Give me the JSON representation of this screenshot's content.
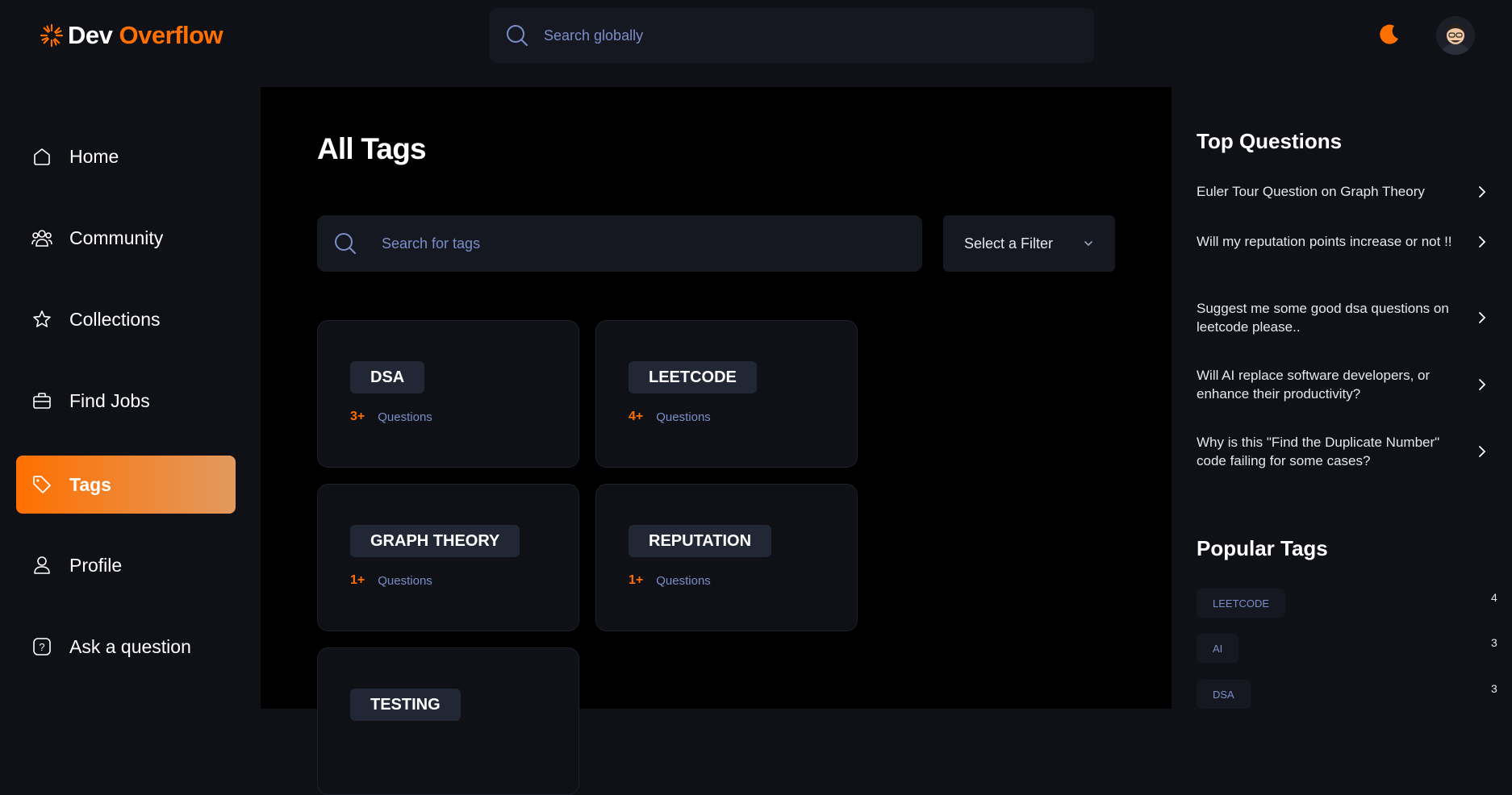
{
  "brand": {
    "name_part1": "Dev",
    "name_part2": "Overflow"
  },
  "header": {
    "search_placeholder": "Search globally",
    "theme_icon": "moon-icon",
    "avatar": "user-avatar"
  },
  "colors": {
    "accent": "#ff7000",
    "background": "#0f1117",
    "main_background": "#000000",
    "muted_text": "#7b8ec8"
  },
  "sidebar": {
    "items": [
      {
        "label": "Home",
        "icon": "home-icon",
        "active": false
      },
      {
        "label": "Community",
        "icon": "users-icon",
        "active": false
      },
      {
        "label": "Collections",
        "icon": "star-icon",
        "active": false
      },
      {
        "label": "Find Jobs",
        "icon": "briefcase-icon",
        "active": false
      },
      {
        "label": "Tags",
        "icon": "tag-icon",
        "active": true
      },
      {
        "label": "Profile",
        "icon": "user-icon",
        "active": false
      },
      {
        "label": "Ask a question",
        "icon": "question-icon",
        "active": false
      }
    ]
  },
  "main": {
    "title": "All Tags",
    "search_placeholder": "Search for tags",
    "filter_label": "Select a Filter",
    "tags": [
      {
        "name": "DSA",
        "count": "3+",
        "label": "Questions"
      },
      {
        "name": "LEETCODE",
        "count": "4+",
        "label": "Questions"
      },
      {
        "name": "GRAPH THEORY",
        "count": "1+",
        "label": "Questions"
      },
      {
        "name": "REPUTATION",
        "count": "1+",
        "label": "Questions"
      },
      {
        "name": "TESTING",
        "count": "",
        "label": ""
      }
    ]
  },
  "right_sidebar": {
    "top_questions_title": "Top Questions",
    "top_questions": [
      "Euler Tour Question on Graph Theory",
      "Will my reputation points increase or not !!",
      "Suggest me some good dsa questions on leetcode please..",
      "Will AI replace software developers, or enhance their productivity?",
      "Why is this \"Find the Duplicate Number\" code failing for some cases?"
    ],
    "popular_tags_title": "Popular Tags",
    "popular_tags": [
      {
        "name": "LEETCODE",
        "count": "4"
      },
      {
        "name": "AI",
        "count": "3"
      },
      {
        "name": "DSA",
        "count": "3"
      }
    ]
  }
}
